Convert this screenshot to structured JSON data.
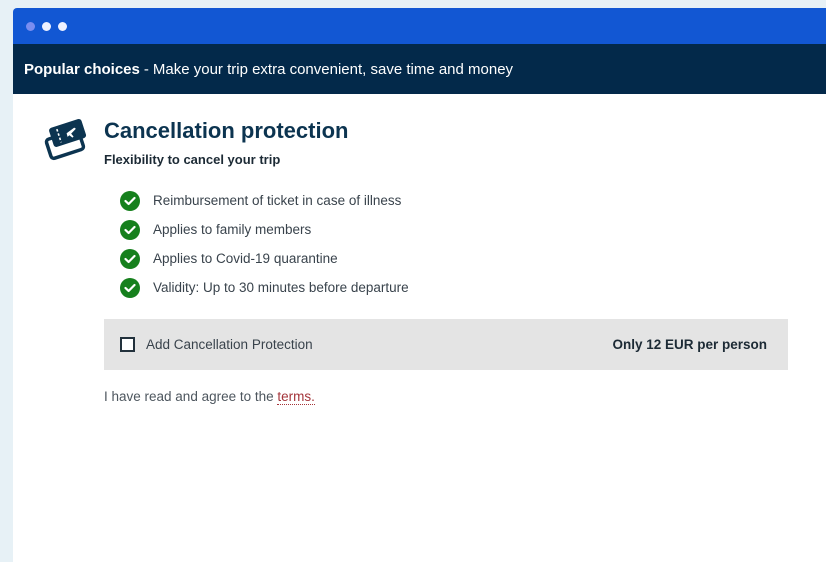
{
  "window": {
    "dots": 3
  },
  "banner": {
    "strong_text": "Popular choices",
    "separator": "-",
    "text": "Make your trip extra convenient, save time and money"
  },
  "product": {
    "icon": "ticket-icon",
    "title": "Cancellation protection",
    "subtitle": "Flexibility to cancel your trip",
    "benefits": [
      "Reimbursement of ticket in case of illness",
      "Applies to family members",
      "Applies to Covid-19 quarantine",
      "Validity: Up to 30 minutes before departure"
    ]
  },
  "option": {
    "checked": false,
    "label": "Add Cancellation Protection",
    "price": "Only 12 EUR per person"
  },
  "terms": {
    "prefix": "I have read and agree to the",
    "link": "terms."
  },
  "colors": {
    "titlebar": "#1257d3",
    "banner": "#03294a",
    "check": "#16801d",
    "link": "#a4343a"
  }
}
